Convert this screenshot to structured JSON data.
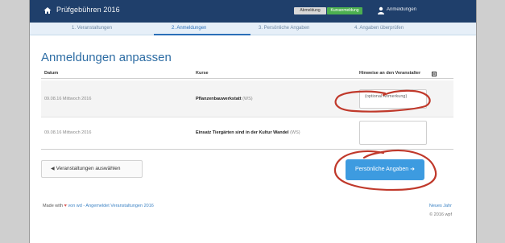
{
  "app": {
    "title": "Prüfgebühren 2016",
    "badges": [
      "Abmeldung",
      "Kursanmeldung"
    ],
    "user_link": "Anmeldungen"
  },
  "steps": [
    {
      "label": "1. Veranstaltungen",
      "active": false
    },
    {
      "label": "2. Anmeldungen",
      "active": true
    },
    {
      "label": "3. Persönliche Angaben",
      "active": false
    },
    {
      "label": "4. Angaben überprüfen",
      "active": false
    }
  ],
  "page_title": "Anmeldungen anpassen",
  "table": {
    "headers": {
      "date": "Datum",
      "course": "Kurse",
      "note": "Hinweise an den Veranstalter"
    },
    "rows": [
      {
        "date": "09.08.16 Mittwoch 2016",
        "course_bold": "Pflanzenbauwerkstatt",
        "course_rest": "(WS)",
        "note_placeholder": "(optional Anmerkung)"
      },
      {
        "date": "09.08.16 Mittwoch 2016",
        "course_bold": "Einsatz Tiergärten sind in der Kultur Wandel",
        "course_rest": "(WS)",
        "note_placeholder": ""
      }
    ]
  },
  "buttons": {
    "select_events": "Veranstaltungen auswählen",
    "next": "Persönliche Angaben"
  },
  "footer": {
    "made_with": "Made with",
    "made_by": "von wd - Angemeldet Veranstaltungen 2016",
    "link1": "Neues Jahr",
    "link2": "© 2016 wpf"
  },
  "colors": {
    "topbar": "#1f3f6b",
    "accent": "#2e6da4",
    "primary_button": "#3d9be0",
    "annotation": "#c0392b"
  }
}
